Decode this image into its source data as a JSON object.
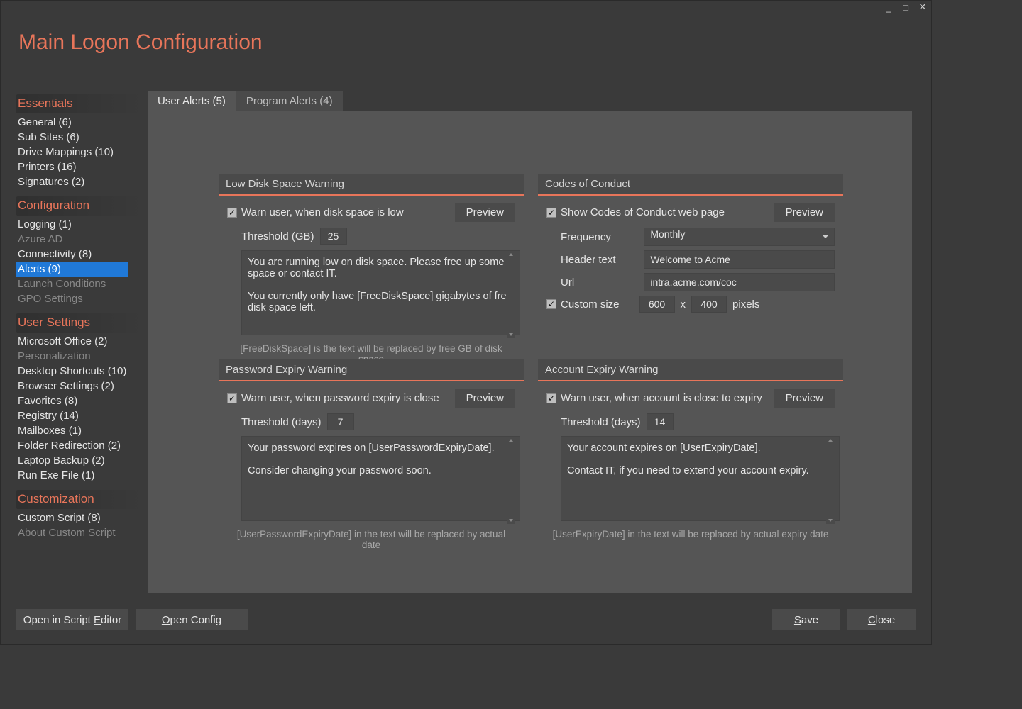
{
  "titlebar": {
    "min": "_",
    "max": "□",
    "close": "✕"
  },
  "page_title": "Main Logon Configuration",
  "sidebar": {
    "sections": [
      {
        "header": "Essentials",
        "items": [
          {
            "label": "General (6)"
          },
          {
            "label": "Sub Sites (6)"
          },
          {
            "label": "Drive Mappings (10)"
          },
          {
            "label": "Printers (16)"
          },
          {
            "label": "Signatures (2)"
          }
        ]
      },
      {
        "header": "Configuration",
        "items": [
          {
            "label": "Logging (1)"
          },
          {
            "label": "Azure AD",
            "disabled": true
          },
          {
            "label": "Connectivity (8)"
          },
          {
            "label": "Alerts (9)",
            "selected": true
          },
          {
            "label": "Launch Conditions",
            "disabled": true
          },
          {
            "label": "GPO Settings",
            "disabled": true
          }
        ]
      },
      {
        "header": "User Settings",
        "items": [
          {
            "label": "Microsoft Office (2)"
          },
          {
            "label": "Personalization",
            "disabled": true
          },
          {
            "label": "Desktop Shortcuts (10)"
          },
          {
            "label": "Browser Settings (2)"
          },
          {
            "label": "Favorites (8)"
          },
          {
            "label": "Registry (14)"
          },
          {
            "label": "Mailboxes (1)"
          },
          {
            "label": "Folder Redirection (2)"
          },
          {
            "label": "Laptop Backup (2)"
          },
          {
            "label": "Run Exe File (1)"
          }
        ]
      },
      {
        "header": "Customization",
        "items": [
          {
            "label": "Custom Script (8)"
          },
          {
            "label": "About Custom Script",
            "disabled": true
          }
        ]
      }
    ]
  },
  "tabs": [
    {
      "label": "User Alerts (5)",
      "active": true
    },
    {
      "label": "Program Alerts (4)"
    }
  ],
  "preview_label": "Preview",
  "cards": {
    "low_disk": {
      "title": "Low Disk Space Warning",
      "warn_label": "Warn user, when disk space is low",
      "threshold_label": "Threshold (GB)",
      "threshold_value": "25",
      "message": "You are running low on disk space. Please free up some space or contact IT.\n\nYou currently only have [FreeDiskSpace] gigabytes of free disk space left.",
      "hint": "[FreeDiskSpace] is the text will be replaced by free GB of disk space"
    },
    "codes": {
      "title": "Codes of Conduct",
      "show_label": "Show Codes of Conduct web page",
      "frequency_label": "Frequency",
      "frequency_value": "Monthly",
      "header_label": "Header text",
      "header_value": "Welcome to Acme",
      "url_label": "Url",
      "url_value": "intra.acme.com/coc",
      "custom_size_label": "Custom size",
      "width": "600",
      "height": "400",
      "x": "x",
      "pixels": "pixels"
    },
    "pwd_expiry": {
      "title": "Password Expiry Warning",
      "warn_label": "Warn user, when password expiry is close",
      "threshold_label": "Threshold (days)",
      "threshold_value": "7",
      "message": "Your password expires on [UserPasswordExpiryDate].\n\nConsider changing your password soon.",
      "hint": "[UserPasswordExpiryDate] in the text will be replaced by actual date"
    },
    "acct_expiry": {
      "title": "Account Expiry Warning",
      "warn_label": "Warn user, when account is close to expiry",
      "threshold_label": "Threshold (days)",
      "threshold_value": "14",
      "message": "Your account expires on [UserExpiryDate].\n\nContact IT, if you need to extend your account expiry.",
      "hint": "[UserExpiryDate] in the text will be replaced by actual expiry date"
    }
  },
  "bottom": {
    "open_editor_pre": "Open in Script ",
    "open_editor_u": "E",
    "open_editor_post": "ditor",
    "open_config_u": "O",
    "open_config_post": "pen Config",
    "save_u": "S",
    "save_post": "ave",
    "close_u": "C",
    "close_post": "lose"
  }
}
